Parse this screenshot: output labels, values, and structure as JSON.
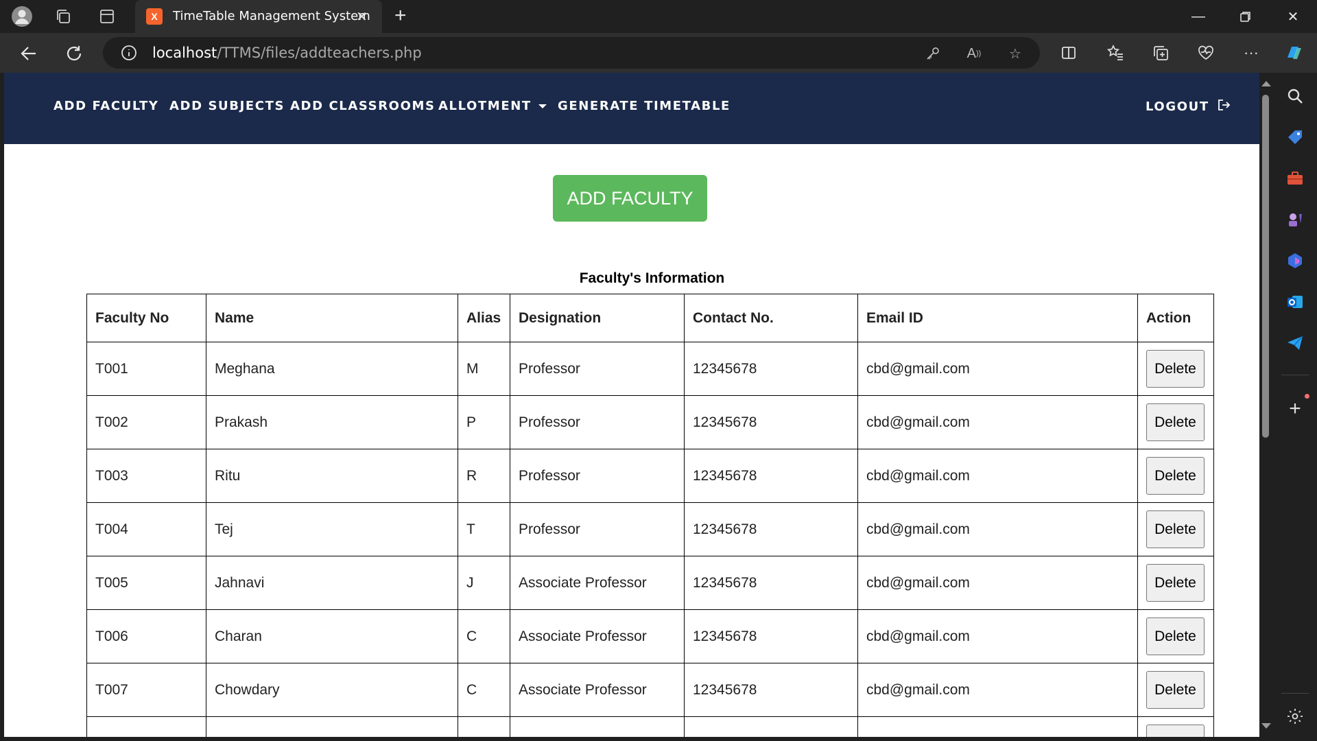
{
  "browser": {
    "tab_title": "TimeTable Management System",
    "tab_favicon_text": "X",
    "url_host": "localhost",
    "url_path": "/TTMS/files/addteachers.php"
  },
  "nav": {
    "items": [
      "ADD FACULTY",
      "ADD SUBJECTS",
      "ADD CLASSROOMS",
      "ALLOTMENT",
      "GENERATE TIMETABLE"
    ],
    "logout": "LOGOUT"
  },
  "page": {
    "add_button": "ADD FACULTY",
    "caption": "Faculty's Information"
  },
  "table": {
    "headers": [
      "Faculty No",
      "Name",
      "Alias",
      "Designation",
      "Contact No.",
      "Email ID",
      "Action"
    ],
    "rows": [
      [
        "T001",
        "Meghana",
        "M",
        "Professor",
        "12345678",
        "cbd@gmail.com",
        "Delete"
      ],
      [
        "T002",
        "Prakash",
        "P",
        "Professor",
        "12345678",
        "cbd@gmail.com",
        "Delete"
      ],
      [
        "T003",
        "Ritu",
        "R",
        "Professor",
        "12345678",
        "cbd@gmail.com",
        "Delete"
      ],
      [
        "T004",
        "Tej",
        "T",
        "Professor",
        "12345678",
        "cbd@gmail.com",
        "Delete"
      ],
      [
        "T005",
        "Jahnavi",
        "J",
        "Associate Professor",
        "12345678",
        "cbd@gmail.com",
        "Delete"
      ],
      [
        "T006",
        "Charan",
        "C",
        "Associate Professor",
        "12345678",
        "cbd@gmail.com",
        "Delete"
      ],
      [
        "T007",
        "Chowdary",
        "C",
        "Associate Professor",
        "12345678",
        "cbd@gmail.com",
        "Delete"
      ]
    ]
  },
  "colors": {
    "navbar": "#1b2a4a",
    "add_button": "#5cb85c",
    "browser_chrome": "#202020"
  }
}
